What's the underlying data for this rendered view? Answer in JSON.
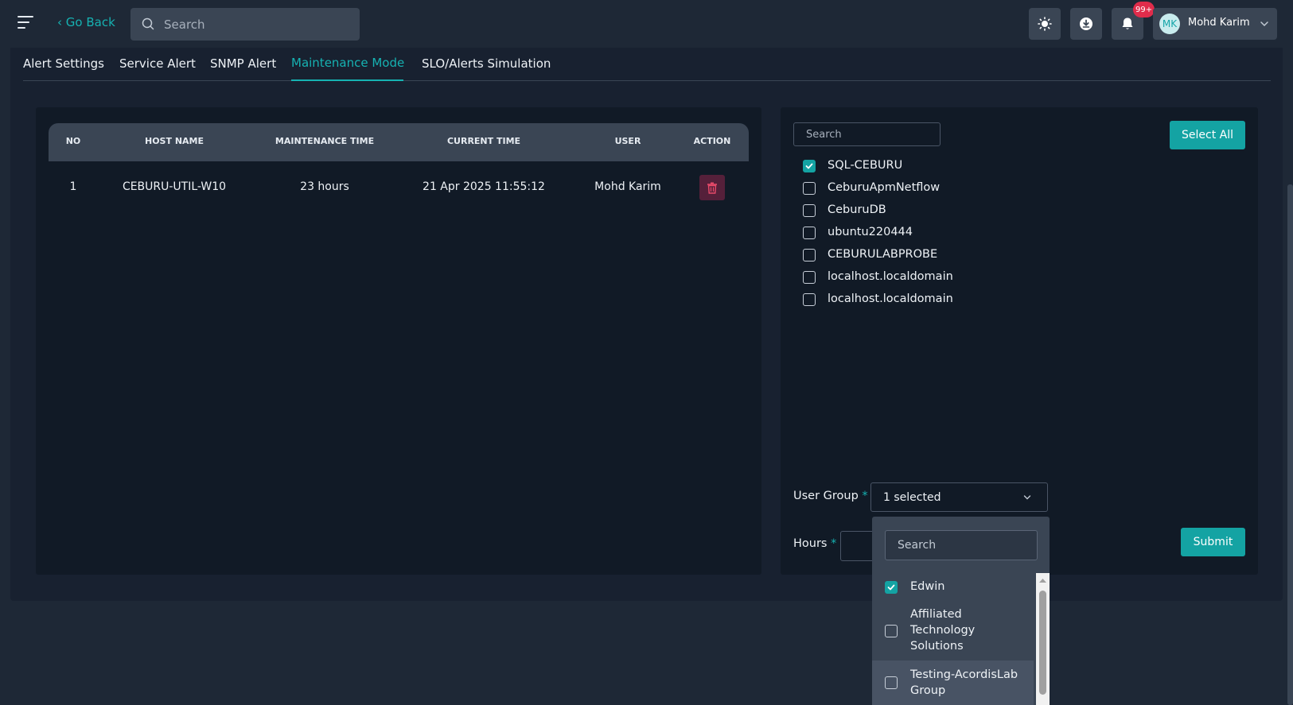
{
  "topbar": {
    "back_label": "Go Back",
    "search_placeholder": "Search",
    "notification_count": "99+",
    "user_initials": "MK",
    "user_name": "Mohd Karim"
  },
  "tabs": [
    {
      "label": "Alert Settings",
      "active": false
    },
    {
      "label": "Service Alert",
      "active": false
    },
    {
      "label": "SNMP Alert",
      "active": false
    },
    {
      "label": "Maintenance Mode",
      "active": true
    },
    {
      "label": "SLO/Alerts Simulation",
      "active": false
    }
  ],
  "table": {
    "headers": [
      "NO",
      "HOST NAME",
      "MAINTENANCE TIME",
      "CURRENT TIME",
      "USER",
      "ACTION"
    ],
    "rows": [
      {
        "no": "1",
        "host_name": "CEBURU-UTIL-W10",
        "maintenance_time": "23 hours",
        "current_time": "21 Apr 2025 11:55:12",
        "user": "Mohd Karim"
      }
    ]
  },
  "hosts_panel": {
    "search_placeholder": "Search",
    "select_all_label": "Select All",
    "hosts": [
      {
        "label": "SQL-CEBURU",
        "checked": true
      },
      {
        "label": "CeburuApmNetflow",
        "checked": false
      },
      {
        "label": "CeburuDB",
        "checked": false
      },
      {
        "label": "ubuntu220444",
        "checked": false
      },
      {
        "label": "CEBURULABPROBE",
        "checked": false
      },
      {
        "label": "localhost.localdomain",
        "checked": false
      },
      {
        "label": "localhost.localdomain",
        "checked": false
      }
    ],
    "user_group_label": "User Group",
    "required_mark": "*",
    "user_group_value": "1 selected",
    "hours_label": "Hours",
    "submit_label": "Submit"
  },
  "user_group_dropdown": {
    "search_placeholder": "Search",
    "options": [
      {
        "label": "Edwin",
        "checked": true
      },
      {
        "label": "Affiliated Technology Solutions",
        "checked": false
      },
      {
        "label": "Testing-AcordisLab Group",
        "checked": false
      }
    ]
  },
  "colors": {
    "accent": "#16b2b2",
    "background": "#1e2836",
    "panel": "#111a26",
    "delete": "#55203a"
  },
  "icons": [
    "menu-icon",
    "chevron-left-icon",
    "search-icon",
    "sun-icon",
    "download-icon",
    "bell-icon",
    "chevron-down-icon",
    "trash-icon",
    "check-icon"
  ]
}
